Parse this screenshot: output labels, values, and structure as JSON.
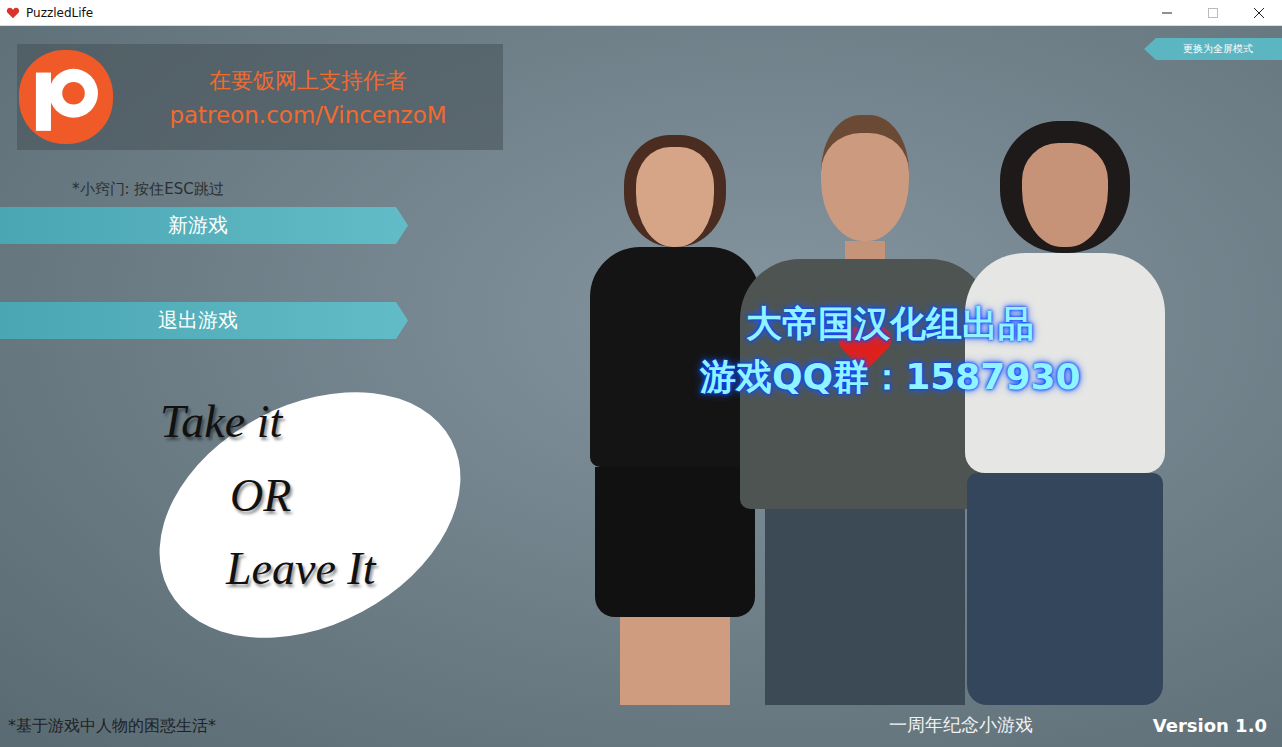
{
  "window": {
    "title": "PuzzledLife"
  },
  "support_banner": {
    "line1": "在要饭网上支持作者",
    "line2": "patreon.com/VincenzoM"
  },
  "fullscreen_button": {
    "label": "更换为全屏模式"
  },
  "tip": "*小窍门: 按住ESC跳过",
  "menu": [
    {
      "label": "新游戏"
    },
    {
      "label": "退出游戏"
    }
  ],
  "slogan": [
    "Take it",
    "OR",
    "Leave It"
  ],
  "tagline": "*基于游戏中人物的困惑生活*",
  "watermark": [
    "大帝国汉化组出品",
    "游戏QQ群：1587930"
  ],
  "footer": {
    "note": "一周年纪念小游戏",
    "version": "Version 1.0"
  }
}
